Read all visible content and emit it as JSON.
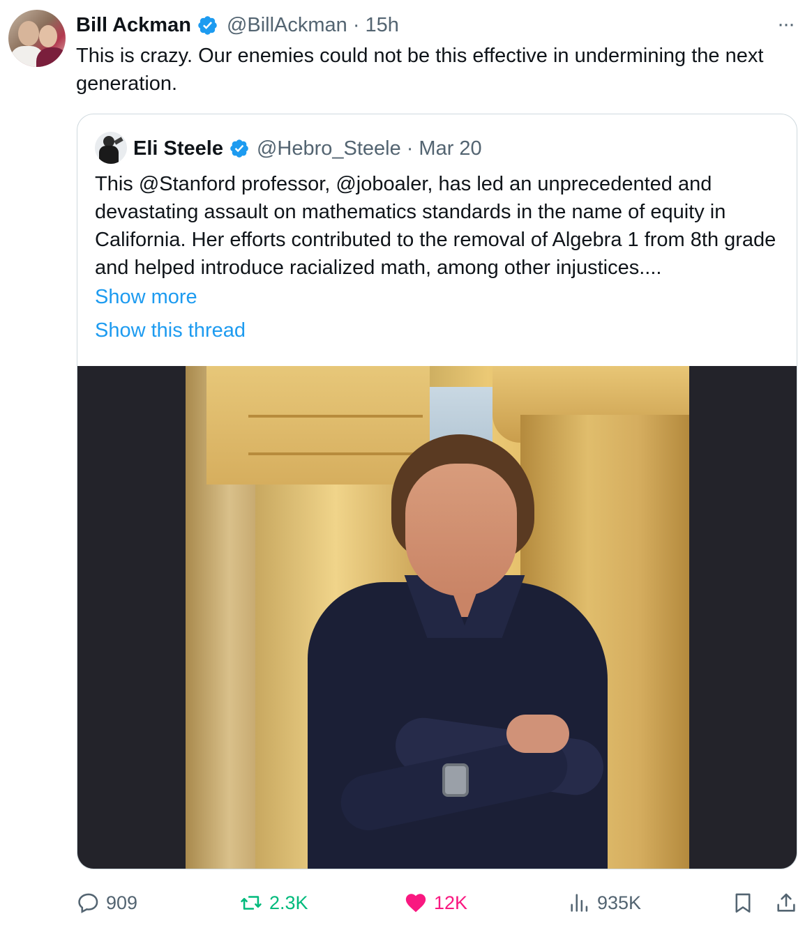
{
  "author": {
    "name": "Bill Ackman",
    "handle": "@BillAckman",
    "separator": "·",
    "time": "15h"
  },
  "more_label": "···",
  "tweet_text": "This is crazy. Our enemies could not be this effective in undermining the next generation.",
  "quote": {
    "name": "Eli Steele",
    "handle": "@Hebro_Steele",
    "separator": "·",
    "date": "Mar 20",
    "text": "This @Stanford professor, @joboaler, has led an unprecedented and devastating assault on mathematics standards in the name of equity in California. Her efforts contributed to the removal of Algebra 1 from 8th grade and helped introduce racialized math, among other injustices....",
    "show_more": "Show more",
    "show_thread": "Show this thread"
  },
  "actions": {
    "replies": "909",
    "retweets": "2.3K",
    "likes": "12K",
    "views": "935K"
  },
  "colors": {
    "verified": "#1d9bf0",
    "link": "#1d9bf0",
    "retweet": "#00ba7c",
    "like": "#f91880",
    "muted": "#536471"
  },
  "icons": [
    "verified-badge-icon",
    "more-icon",
    "reply-icon",
    "retweet-icon",
    "heart-icon",
    "views-icon",
    "bookmark-icon",
    "share-icon"
  ]
}
